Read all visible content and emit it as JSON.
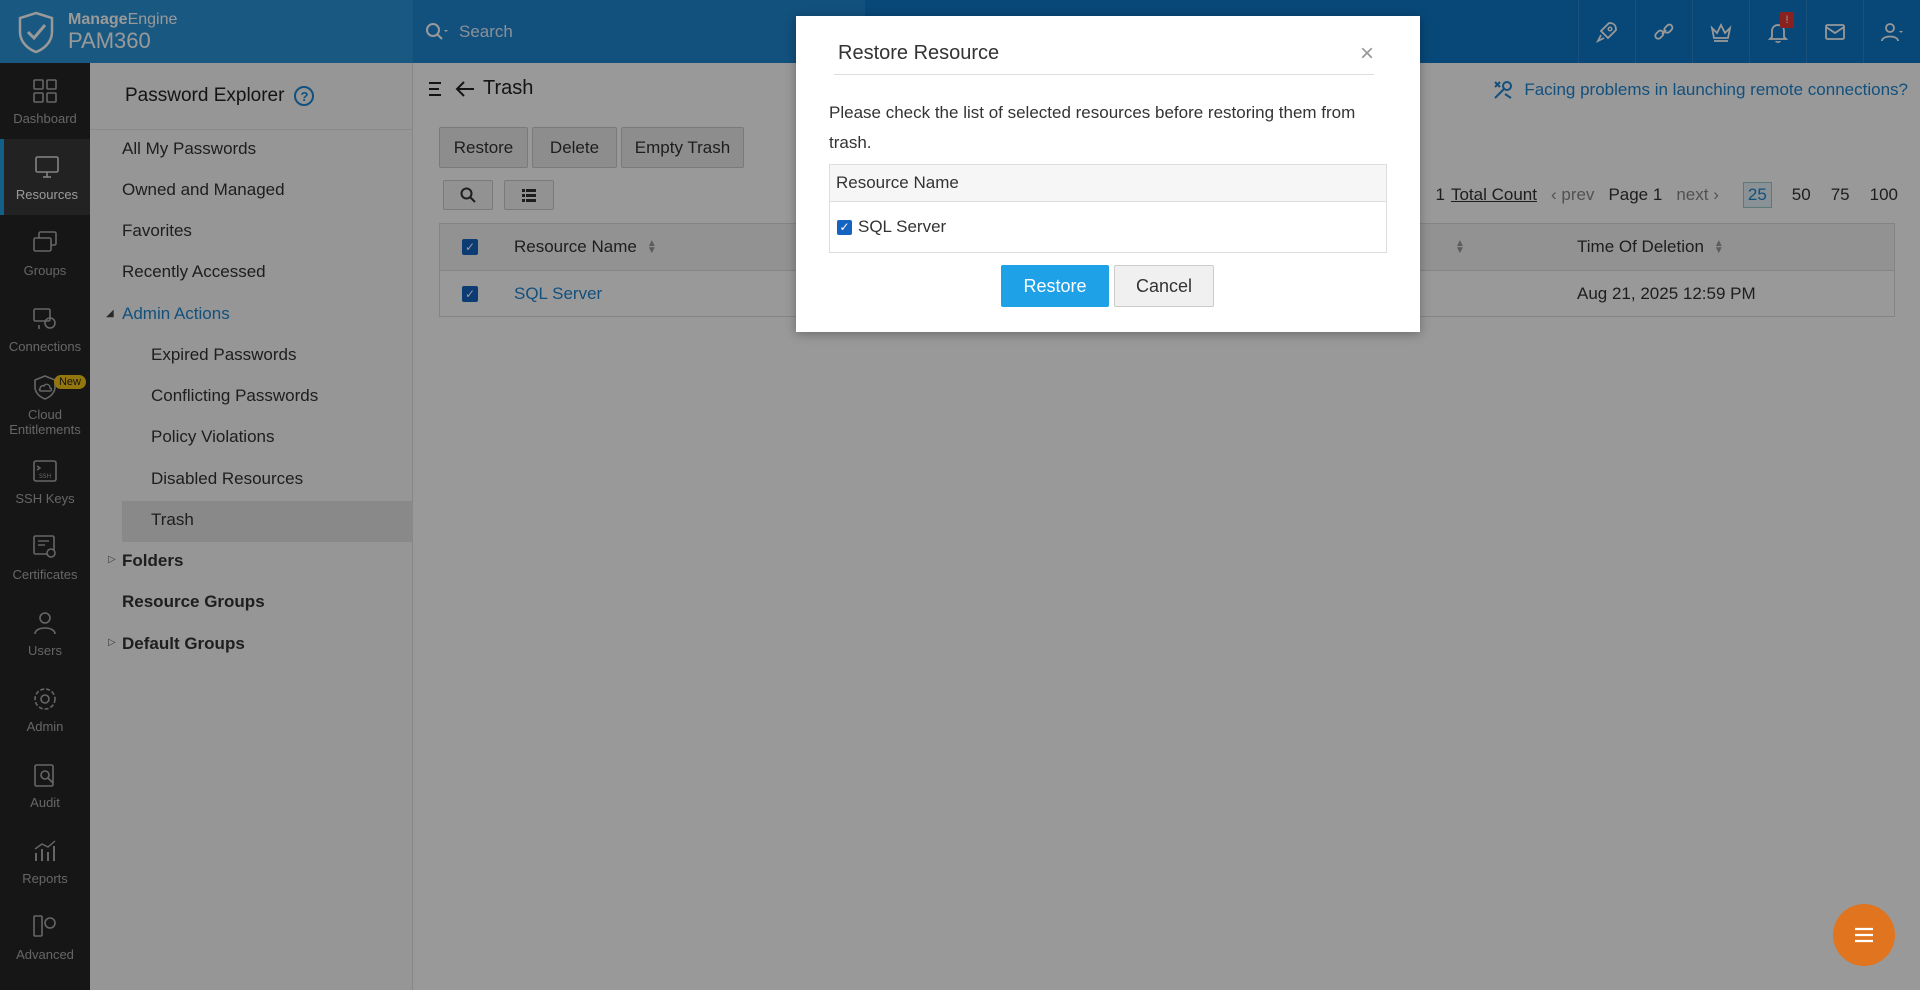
{
  "header": {
    "brand_top_bold": "Manage",
    "brand_top_rest": "Engine",
    "product": "PAM360",
    "search_placeholder": "Search",
    "notification_count": "!"
  },
  "leftnav": {
    "items": [
      {
        "label": "Dashboard",
        "icon": "dashboard-icon"
      },
      {
        "label": "Resources",
        "icon": "monitor-icon",
        "active": true
      },
      {
        "label": "Groups",
        "icon": "groups-icon"
      },
      {
        "label": "Connections",
        "icon": "connections-icon"
      },
      {
        "label": "Cloud\nEntitlements",
        "icon": "cloud-icon",
        "badge": "New"
      },
      {
        "label": "SSH Keys",
        "icon": "ssh-icon"
      },
      {
        "label": "Certificates",
        "icon": "certificate-icon"
      },
      {
        "label": "Users",
        "icon": "user-icon"
      },
      {
        "label": "Admin",
        "icon": "gear-icon"
      },
      {
        "label": "Audit",
        "icon": "audit-icon"
      },
      {
        "label": "Reports",
        "icon": "reports-icon"
      },
      {
        "label": "Advanced",
        "icon": "advanced-icon"
      }
    ],
    "labels": {
      "dashboard": "Dashboard",
      "resources": "Resources",
      "groups": "Groups",
      "connections": "Connections",
      "cloud1": "Cloud",
      "cloud2": "Entitlements",
      "cloud_badge": "New",
      "ssh": "SSH Keys",
      "certificates": "Certificates",
      "users": "Users",
      "admin": "Admin",
      "audit": "Audit",
      "reports": "Reports",
      "advanced": "Advanced"
    }
  },
  "tree": {
    "title": "Password Explorer",
    "help": "?",
    "all_my_passwords": "All My Passwords",
    "owned_and_managed": "Owned and Managed",
    "favorites": "Favorites",
    "recently_accessed": "Recently Accessed",
    "admin_actions": "Admin Actions",
    "expired_passwords": "Expired Passwords",
    "conflicting_passwords": "Conflicting Passwords",
    "policy_violations": "Policy Violations",
    "disabled_resources": "Disabled Resources",
    "trash": "Trash",
    "folders": "Folders",
    "resource_groups": "Resource Groups",
    "default_groups": "Default Groups"
  },
  "main": {
    "title": "Trash",
    "help_link": "Facing problems in launching remote connections?",
    "buttons": {
      "restore": "Restore",
      "delete": "Delete",
      "empty_trash": "Empty Trash"
    },
    "pager": {
      "count": "1",
      "total_count": "Total Count",
      "prev": "prev",
      "page": "Page 1",
      "next": "next",
      "sizes": [
        "25",
        "50",
        "75",
        "100"
      ],
      "selected_size": "25"
    },
    "table": {
      "columns": {
        "resource_name": "Resource Name",
        "time_of_deletion": "Time Of Deletion"
      },
      "rows": [
        {
          "resource_name": "SQL Server",
          "time_of_deletion": "Aug 21, 2025 12:59 PM"
        }
      ]
    }
  },
  "modal": {
    "title": "Restore Resource",
    "close": "×",
    "message": "Please check the list of selected resources before restoring them from trash.",
    "column": "Resource Name",
    "items": [
      "SQL Server"
    ],
    "restore_label": "Restore",
    "cancel_label": "Cancel"
  },
  "colors": {
    "header": "#0e78c9",
    "accent": "#1ea1e6",
    "nav_bg": "#262626",
    "fab": "#e0741f"
  }
}
